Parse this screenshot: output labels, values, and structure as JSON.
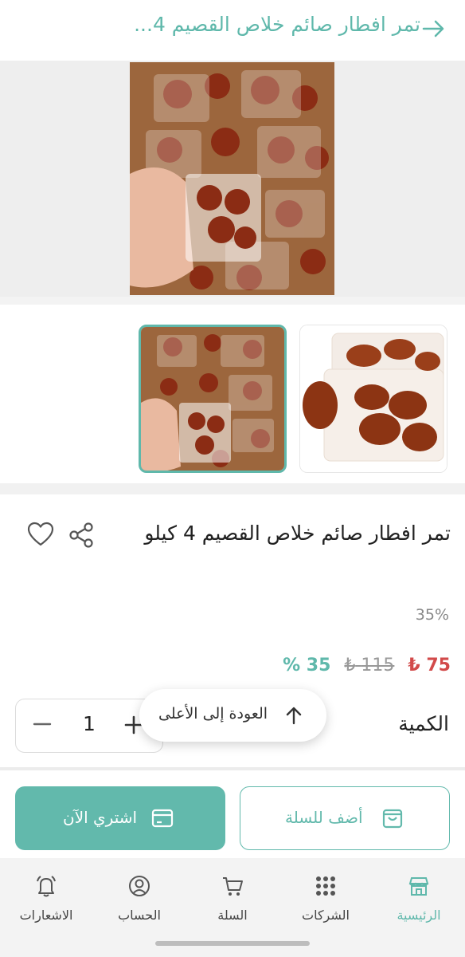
{
  "header": {
    "title": "تمر افطار صائم خلاص القصيم 4...",
    "back_icon": "arrow-right-icon"
  },
  "product": {
    "name": "تمر افطار صائم خلاص القصيم 4 كيلو",
    "discount_percent": "35%",
    "price_new": "75",
    "price_old": "115",
    "discount_label": "35 %",
    "currency_symbol": "₺"
  },
  "quantity": {
    "label": "الكمية",
    "value": "1",
    "minus": "−",
    "plus": "+"
  },
  "back_to_top": {
    "label": "العودة إلى الأعلى"
  },
  "actions": {
    "buy_now": "اشتري الآن",
    "add_to_cart": "أضف للسلة"
  },
  "tabs": [
    {
      "label": "الرئيسية",
      "icon": "store-icon",
      "active": true
    },
    {
      "label": "الشركات",
      "icon": "grid-icon",
      "active": false
    },
    {
      "label": "السلة",
      "icon": "cart-icon",
      "active": false
    },
    {
      "label": "الحساب",
      "icon": "user-icon",
      "active": false
    },
    {
      "label": "الاشعارات",
      "icon": "bell-icon",
      "active": false
    }
  ],
  "colors": {
    "accent": "#5fb8ab",
    "price": "#d24a4a"
  }
}
